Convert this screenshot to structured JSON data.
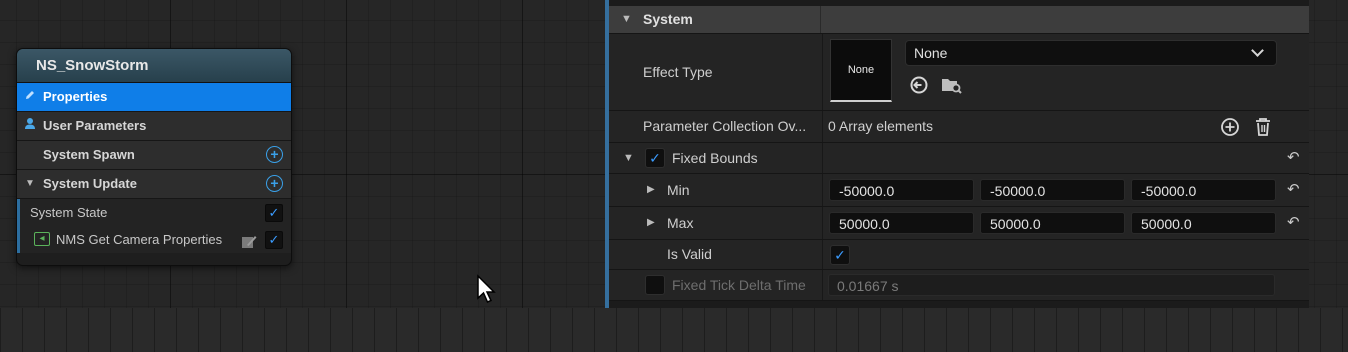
{
  "node": {
    "title": "NS_SnowStorm",
    "rows": [
      {
        "label": "Properties",
        "icon": "pencil-icon"
      },
      {
        "label": "User Parameters",
        "icon": "user-icon"
      },
      {
        "label": "System Spawn"
      },
      {
        "label": "System Update"
      }
    ],
    "modules": [
      {
        "label": "System State",
        "checked": true
      },
      {
        "label": "NMS Get Camera Properties",
        "checked": true
      }
    ]
  },
  "panel": {
    "category": "System",
    "effect_type": {
      "label": "Effect Type",
      "thumb": "None",
      "value": "None"
    },
    "param_collection": {
      "label": "Parameter Collection Ov...",
      "value": "0 Array elements"
    },
    "fixed_bounds": {
      "label": "Fixed Bounds",
      "checked": true,
      "min": {
        "label": "Min",
        "values": [
          "-50000.0",
          "-50000.0",
          "-50000.0"
        ]
      },
      "max": {
        "label": "Max",
        "values": [
          "50000.0",
          "50000.0",
          "50000.0"
        ]
      },
      "is_valid": {
        "label": "Is Valid",
        "checked": true
      }
    },
    "fixed_tick": {
      "label": "Fixed Tick Delta Time",
      "value": "0.01667 s",
      "checked": false
    }
  },
  "colors": {
    "accent": "#0f7ee8",
    "panel_border": "#356f9e",
    "check": "#3b9cff"
  }
}
